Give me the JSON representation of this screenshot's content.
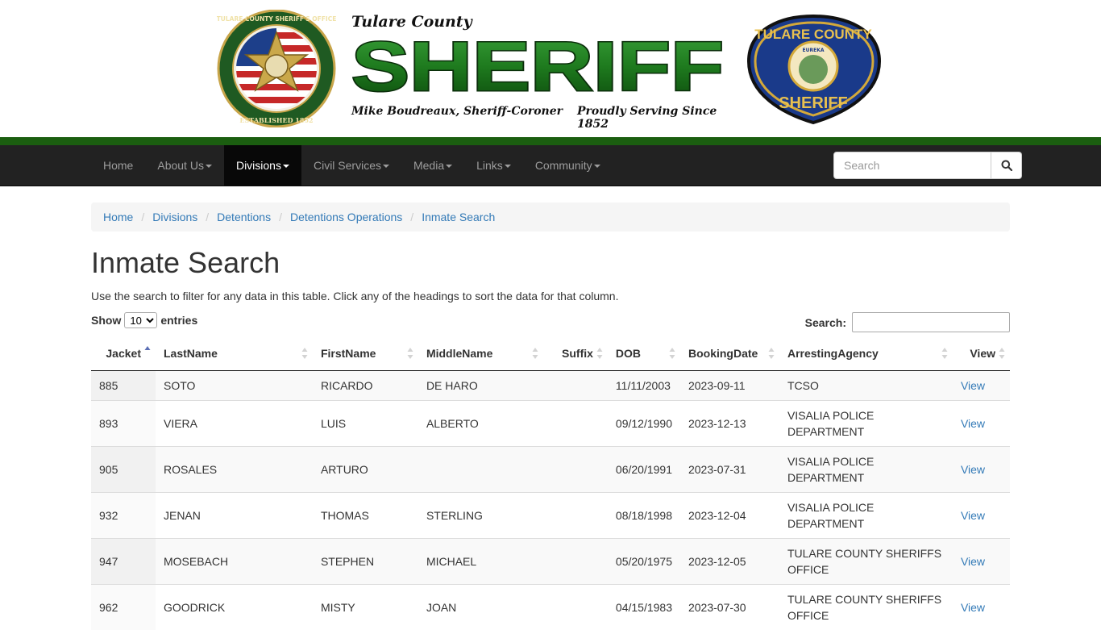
{
  "banner": {
    "county": "Tulare County",
    "title": "SHERIFF",
    "left_line": "Mike Boudreaux, Sheriff-Coroner",
    "right_line": "Proudly Serving Since 1852",
    "left_seal_text": "TULARE COUNTY SHERIFF'S OFFICE · ESTABLISHED 1852",
    "right_patch_text": "TULARE COUNTY SHERIFF · EUREKA"
  },
  "nav": {
    "items": [
      {
        "label": "Home",
        "dropdown": false,
        "active": false
      },
      {
        "label": "About Us",
        "dropdown": true,
        "active": false
      },
      {
        "label": "Divisions",
        "dropdown": true,
        "active": true
      },
      {
        "label": "Civil Services",
        "dropdown": true,
        "active": false
      },
      {
        "label": "Media",
        "dropdown": true,
        "active": false
      },
      {
        "label": "Links",
        "dropdown": true,
        "active": false
      },
      {
        "label": "Community",
        "dropdown": true,
        "active": false
      }
    ],
    "search_placeholder": "Search",
    "search_icon": "search-icon"
  },
  "breadcrumb": [
    "Home",
    "Divisions",
    "Detentions",
    "Detentions Operations",
    "Inmate Search"
  ],
  "page": {
    "title": "Inmate Search",
    "intro": "Use the search to filter for any data in this table. Click any of the headings to sort the data for that column.",
    "show_label": "Show",
    "entries_value": "10",
    "entries_label": "entries",
    "search_label": "Search:"
  },
  "table": {
    "headers": [
      "Jacket",
      "LastName",
      "FirstName",
      "MiddleName",
      "Suffix",
      "DOB",
      "BookingDate",
      "ArrestingAgency",
      "View"
    ],
    "rows": [
      {
        "jacket": "885",
        "last": "SOTO",
        "first": "RICARDO",
        "middle": "DE HARO",
        "suffix": "",
        "dob": "11/11/2003",
        "booking": "2023-09-11",
        "agency": [
          "TCSO"
        ],
        "view": "View"
      },
      {
        "jacket": "893",
        "last": "VIERA",
        "first": "LUIS",
        "middle": "ALBERTO",
        "suffix": "",
        "dob": "09/12/1990",
        "booking": "2023-12-13",
        "agency": [
          "VISALIA POLICE",
          "DEPARTMENT"
        ],
        "view": "View"
      },
      {
        "jacket": "905",
        "last": "ROSALES",
        "first": "ARTURO",
        "middle": "",
        "suffix": "",
        "dob": "06/20/1991",
        "booking": "2023-07-31",
        "agency": [
          "VISALIA POLICE",
          "DEPARTMENT"
        ],
        "view": "View"
      },
      {
        "jacket": "932",
        "last": "JENAN",
        "first": "THOMAS",
        "middle": "STERLING",
        "suffix": "",
        "dob": "08/18/1998",
        "booking": "2023-12-04",
        "agency": [
          "VISALIA POLICE",
          "DEPARTMENT"
        ],
        "view": "View"
      },
      {
        "jacket": "947",
        "last": "MOSEBACH",
        "first": "STEPHEN",
        "middle": "MICHAEL",
        "suffix": "",
        "dob": "05/20/1975",
        "booking": "2023-12-05",
        "agency": [
          "TULARE COUNTY SHERIFFS",
          "OFFICE"
        ],
        "view": "View"
      },
      {
        "jacket": "962",
        "last": "GOODRICK",
        "first": "MISTY",
        "middle": "JOAN",
        "suffix": "",
        "dob": "04/15/1983",
        "booking": "2023-07-30",
        "agency": [
          "TULARE COUNTY SHERIFFS",
          "OFFICE"
        ],
        "view": "View"
      }
    ]
  },
  "colors": {
    "navbar": "#222222",
    "nav_active": "#080808",
    "green_band": "#1b5e10",
    "link": "#337ab7",
    "banner_green": "#1e7a1e"
  }
}
